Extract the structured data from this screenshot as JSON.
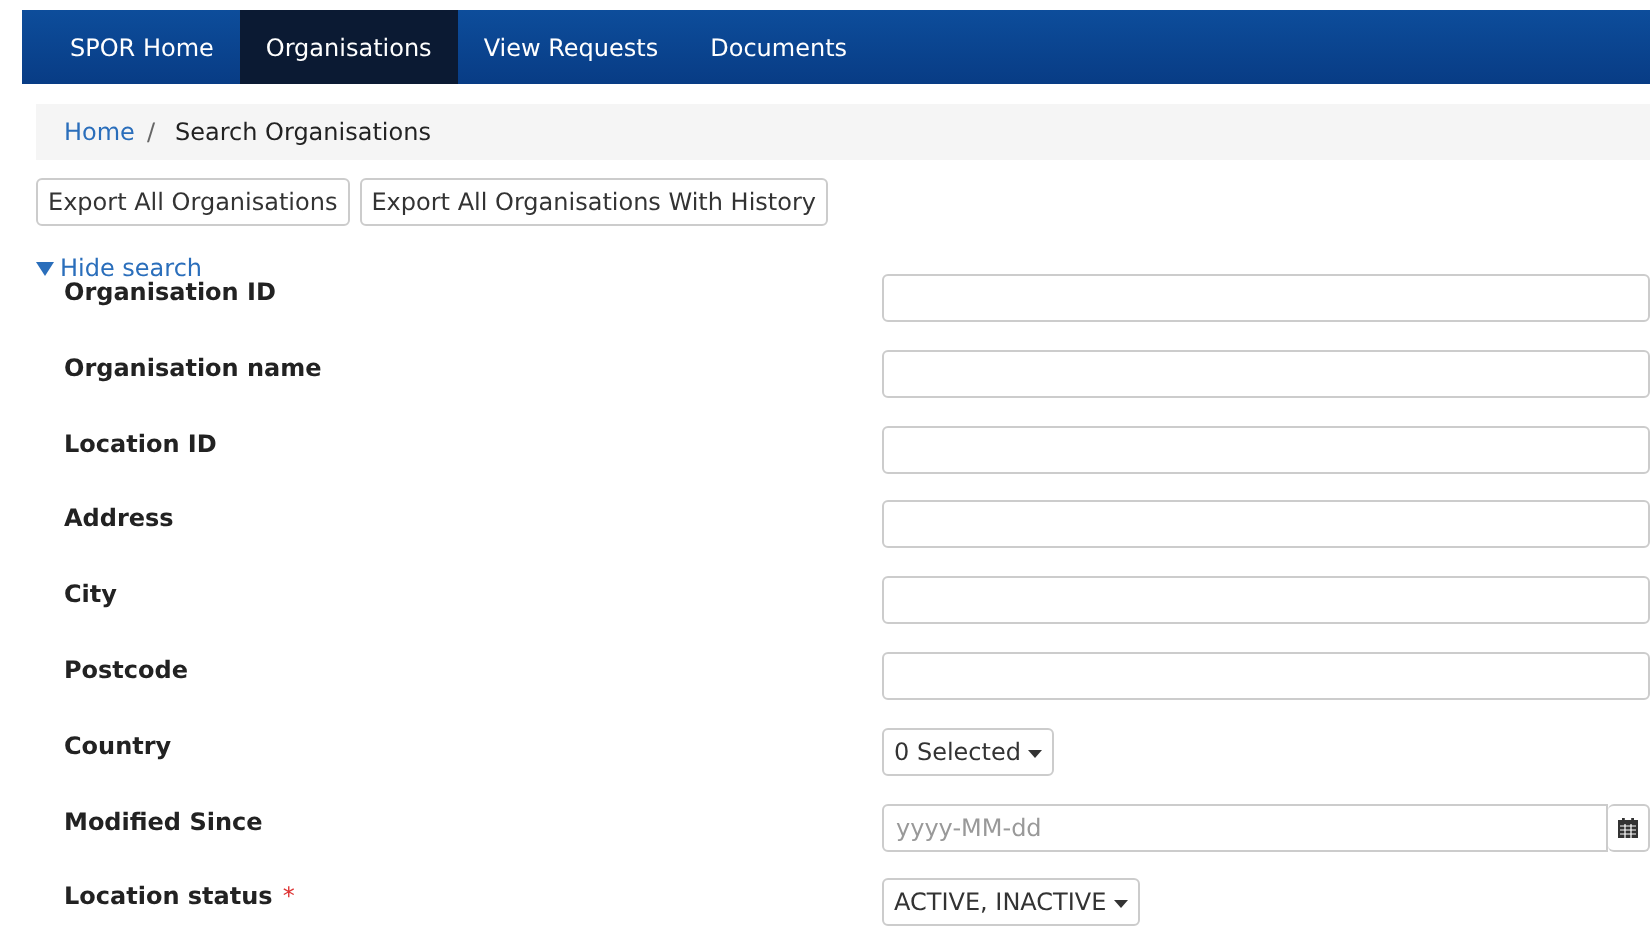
{
  "nav": {
    "items": [
      {
        "label": "SPOR Home",
        "selected": false
      },
      {
        "label": "Organisations",
        "selected": true
      },
      {
        "label": "View Requests",
        "selected": false
      },
      {
        "label": "Documents",
        "selected": false
      }
    ]
  },
  "breadcrumb": {
    "link": "Home",
    "separator": "/",
    "current": "Search Organisations"
  },
  "buttons": [
    "Export All Organisations",
    "Export All Organisations With History"
  ],
  "search_toggle": {
    "label": "Hide search",
    "expanded": true
  },
  "fields": [
    {
      "label": "Organisation ID",
      "kind": "text"
    },
    {
      "label": "Organisation name",
      "kind": "text"
    },
    {
      "label": "Location ID",
      "kind": "text"
    },
    {
      "label": "Address",
      "kind": "text"
    },
    {
      "label": "City",
      "kind": "text"
    },
    {
      "label": "Postcode",
      "kind": "text"
    },
    {
      "label": "Country",
      "kind": "dropdown",
      "value": "0 Selected"
    },
    {
      "label": "Modified Since",
      "kind": "date",
      "placeholder": "yyyy-MM-dd"
    },
    {
      "label": "Location status",
      "kind": "dropdown",
      "value": "ACTIVE, INACTIVE",
      "required_mark": "*"
    }
  ]
}
